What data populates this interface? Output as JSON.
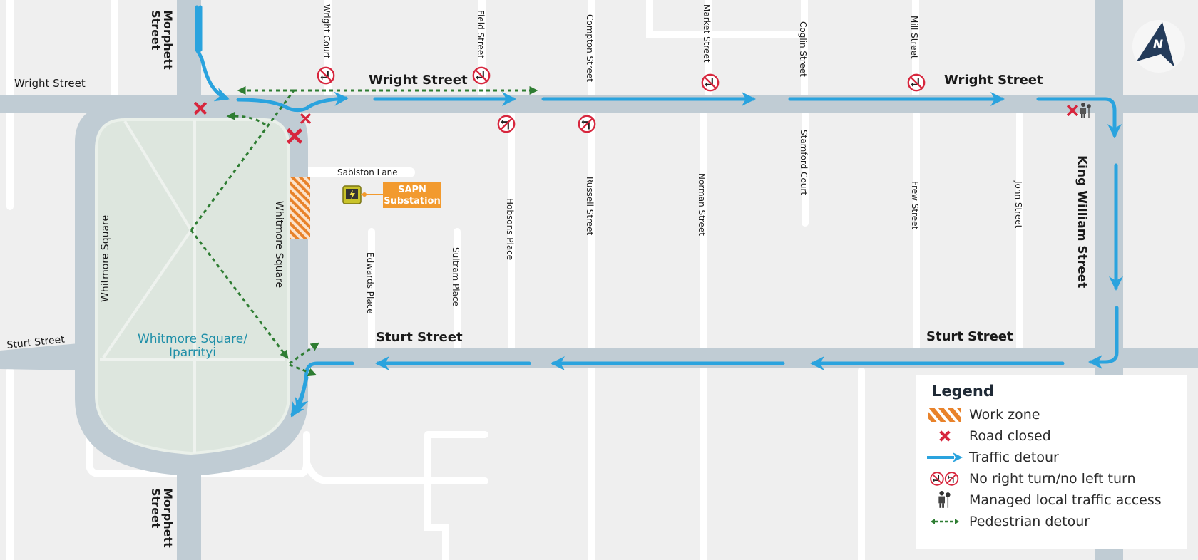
{
  "map": {
    "type": "traffic-detour-map",
    "colors": {
      "background": "#efefef",
      "road": "#c0ccd4",
      "minor_street": "#ffffff",
      "park": "#dde6de",
      "traffic_detour": "#2aa3de",
      "pedestrian_detour": "#2e7d32",
      "road_closed": "#d7263d",
      "work_zone": "#e8822a",
      "substation_label": "#f29a2e",
      "park_label": "#1f8fa8",
      "north_arrow": "#243b5a"
    },
    "north_arrow_label": "N",
    "streets": {
      "wright_street_west": "Wright Street",
      "wright_street_main": "Wright Street",
      "wright_street_east": "Wright Street",
      "sturt_street_west": "Sturt Street",
      "sturt_street_main": "Sturt Street",
      "sturt_street_east": "Sturt Street",
      "morphett_north_1": "Morphett",
      "morphett_north_2": "Street",
      "morphett_south_1": "Morphett",
      "morphett_south_2": "Street",
      "whitmore_square_west": "Whitmore Square",
      "whitmore_square_east": "Whitmore Square",
      "king_william": "King William Street",
      "wright_court": "Wright Court",
      "field_street": "Field Street",
      "compton_street": "Compton Street",
      "market_street": "Market Street",
      "coglin_street": "Coglin Street",
      "mill_street": "Mill Street",
      "sabiston_lane": "Sabiston Lane",
      "hobsons_place": "Hobsons Place",
      "russell_street": "Russell Street",
      "norman_street": "Norman Street",
      "stamford_court": "Stamford Court",
      "frew_street": "Frew Street",
      "john_street": "John Street",
      "edwards_place": "Edwards Place",
      "sultram_place": "Sultram Place"
    },
    "park_label_line1": "Whitmore Square/",
    "park_label_line2": "Iparrityi",
    "substation_line1": "SAPN",
    "substation_line2": "Substation"
  },
  "legend": {
    "title": "Legend",
    "items": [
      {
        "icon": "work-zone-hatch-icon",
        "label": "Work zone"
      },
      {
        "icon": "road-closed-x-icon",
        "label": "Road closed"
      },
      {
        "icon": "traffic-detour-arrow-icon",
        "label": "Traffic detour"
      },
      {
        "icon": "no-turn-sign-icon",
        "label": "No right turn/no left turn"
      },
      {
        "icon": "traffic-controller-icon",
        "label": "Managed local traffic access"
      },
      {
        "icon": "pedestrian-detour-arrow-icon",
        "label": "Pedestrian detour"
      }
    ]
  }
}
